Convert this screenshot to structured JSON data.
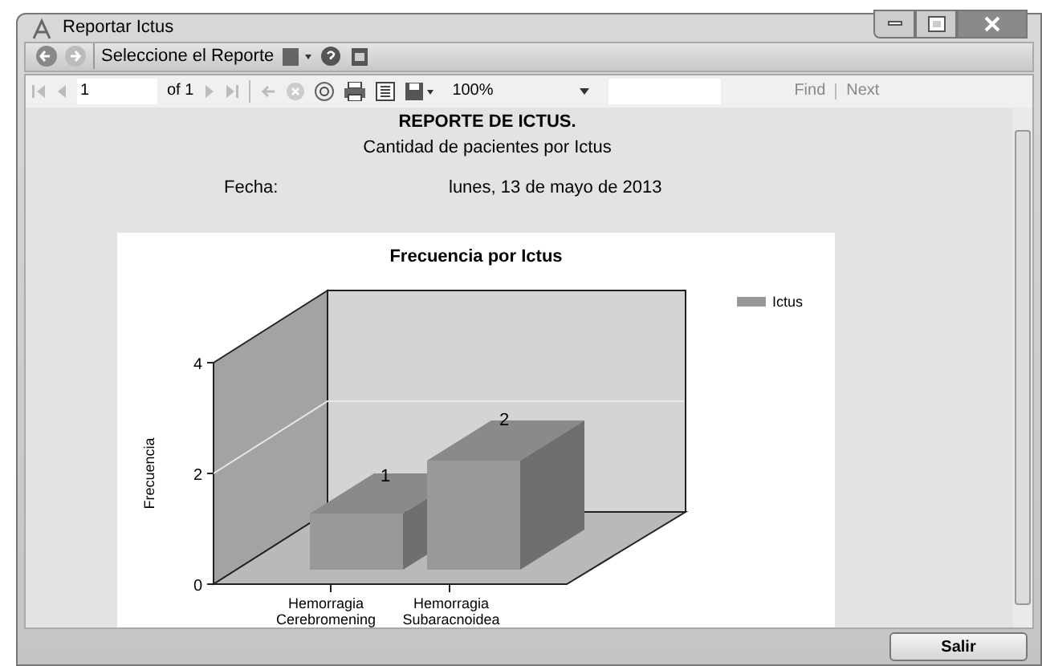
{
  "window": {
    "title": "Reportar Ictus"
  },
  "toolbar": {
    "label": "Seleccione el Reporte"
  },
  "report_toolbar": {
    "page": "1",
    "page_total": "of 1",
    "zoom": "100%",
    "find": "Find",
    "next": "Next"
  },
  "report": {
    "title": "REPORTE DE ICTUS.",
    "subtitle": "Cantidad de pacientes por Ictus",
    "date_label": "Fecha:",
    "date_value": "lunes, 13 de mayo de 2013",
    "chart": {
      "title": "Frecuencia por Ictus",
      "y_label": "Frecuencia",
      "y_ticks": [
        "4",
        "2",
        "0"
      ],
      "bars": [
        {
          "category": "Hemorragia Cerebromening",
          "value_label": "1"
        },
        {
          "category": "Hemorragia Subaracnoidea",
          "value_label": "2"
        }
      ],
      "legend": "Ictus"
    }
  },
  "footer": {
    "button": "Salir"
  }
}
